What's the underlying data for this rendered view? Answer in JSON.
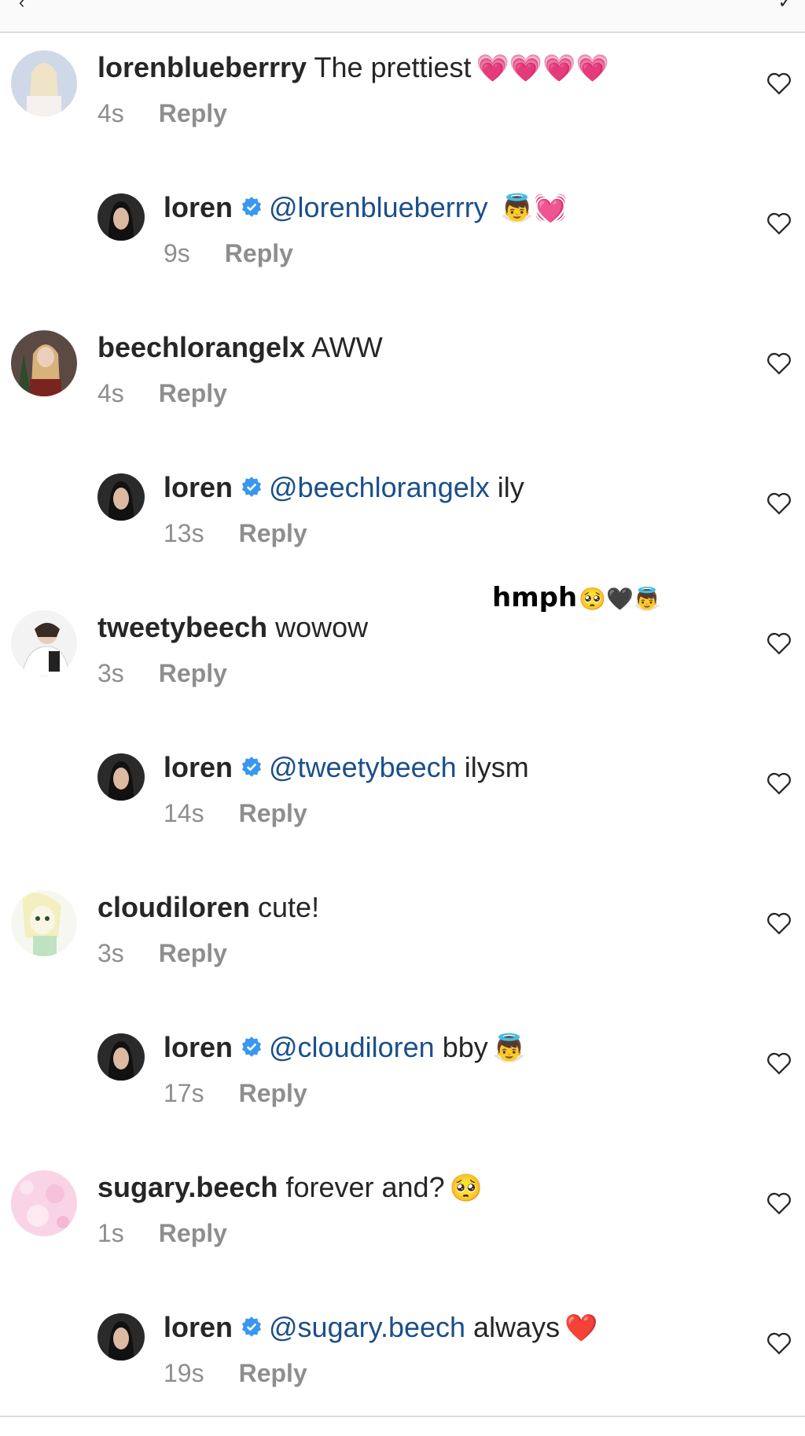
{
  "comments": [
    {
      "user": "lorenblueberrry",
      "text": "The prettiest",
      "emoji": "💗💗💗💗",
      "time": "4s",
      "reply_label": "Reply"
    },
    {
      "user": "loren",
      "mention": "@lorenblueberrry",
      "text": "",
      "emoji": "👼💓",
      "time": "9s",
      "reply_label": "Reply"
    },
    {
      "user": "beechlorangelx",
      "text": "AWW",
      "emoji": "",
      "time": "4s",
      "reply_label": "Reply"
    },
    {
      "user": "loren",
      "mention": "@beechlorangelx",
      "text": "ily",
      "emoji": "",
      "time": "13s",
      "reply_label": "Reply"
    },
    {
      "user": "tweetybeech",
      "text": "wowow",
      "emoji": "",
      "time": "3s",
      "reply_label": "Reply"
    },
    {
      "user": "loren",
      "mention": "@tweetybeech",
      "text": "ilysm",
      "emoji": "",
      "time": "14s",
      "reply_label": "Reply"
    },
    {
      "user": "cloudiloren",
      "text": "cute!",
      "emoji": "",
      "time": "3s",
      "reply_label": "Reply"
    },
    {
      "user": "loren",
      "mention": "@cloudiloren",
      "text": "bby",
      "emoji": "👼",
      "time": "17s",
      "reply_label": "Reply"
    },
    {
      "user": "sugary.beech",
      "text": "forever and?",
      "emoji": "🥺",
      "time": "1s",
      "reply_label": "Reply"
    },
    {
      "user": "loren",
      "mention": "@sugary.beech",
      "text": "always",
      "emoji": "❤️",
      "time": "19s",
      "reply_label": "Reply"
    }
  ],
  "overlay": {
    "text": "hmph",
    "emoji": "🥺🖤👼"
  },
  "colors": {
    "mention": "#1b4f8a",
    "meta": "#8e8e8e",
    "verified": "#3897f0",
    "text": "#262626"
  },
  "icons": {
    "like": "heart-outline-icon",
    "verified": "verified-badge-icon"
  }
}
